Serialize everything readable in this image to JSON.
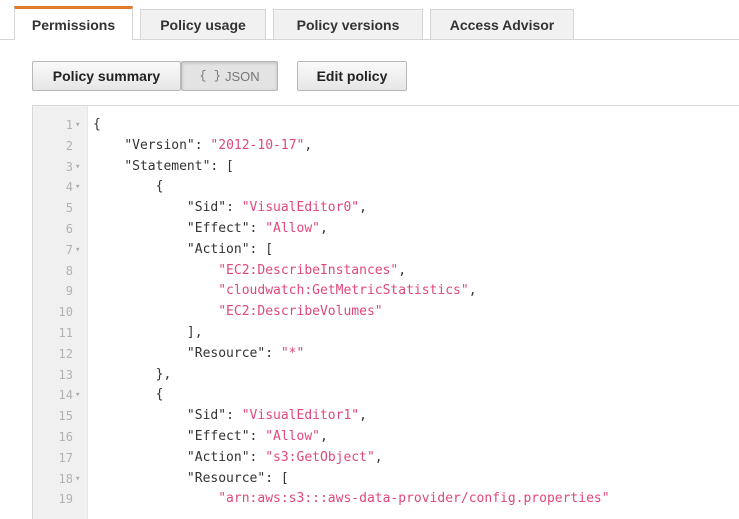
{
  "tabs": [
    {
      "label": "Permissions",
      "active": true
    },
    {
      "label": "Policy usage",
      "active": false
    },
    {
      "label": "Policy versions",
      "active": false
    },
    {
      "label": "Access Advisor",
      "active": false
    }
  ],
  "toolbar": {
    "policy_summary_label": "Policy summary",
    "json_braces": "{ }",
    "json_label": "JSON",
    "edit_policy_label": "Edit policy"
  },
  "colors": {
    "active_tab_accent": "#e07b2c",
    "json_string": "#e0487b",
    "json_key": "#333333"
  },
  "editor": {
    "lines": [
      {
        "n": "1",
        "fold": true,
        "indent": 0,
        "segs": [
          {
            "t": "p",
            "v": "{"
          }
        ]
      },
      {
        "n": "2",
        "fold": false,
        "indent": 1,
        "segs": [
          {
            "t": "k",
            "v": "\"Version\""
          },
          {
            "t": "p",
            "v": ": "
          },
          {
            "t": "s",
            "v": "\"2012-10-17\""
          },
          {
            "t": "p",
            "v": ","
          }
        ]
      },
      {
        "n": "3",
        "fold": true,
        "indent": 1,
        "segs": [
          {
            "t": "k",
            "v": "\"Statement\""
          },
          {
            "t": "p",
            "v": ": ["
          }
        ]
      },
      {
        "n": "4",
        "fold": true,
        "indent": 2,
        "segs": [
          {
            "t": "p",
            "v": "{"
          }
        ]
      },
      {
        "n": "5",
        "fold": false,
        "indent": 3,
        "segs": [
          {
            "t": "k",
            "v": "\"Sid\""
          },
          {
            "t": "p",
            "v": ": "
          },
          {
            "t": "s",
            "v": "\"VisualEditor0\""
          },
          {
            "t": "p",
            "v": ","
          }
        ]
      },
      {
        "n": "6",
        "fold": false,
        "indent": 3,
        "segs": [
          {
            "t": "k",
            "v": "\"Effect\""
          },
          {
            "t": "p",
            "v": ": "
          },
          {
            "t": "s",
            "v": "\"Allow\""
          },
          {
            "t": "p",
            "v": ","
          }
        ]
      },
      {
        "n": "7",
        "fold": true,
        "indent": 3,
        "segs": [
          {
            "t": "k",
            "v": "\"Action\""
          },
          {
            "t": "p",
            "v": ": ["
          }
        ]
      },
      {
        "n": "8",
        "fold": false,
        "indent": 4,
        "segs": [
          {
            "t": "s",
            "v": "\"EC2:DescribeInstances\""
          },
          {
            "t": "p",
            "v": ","
          }
        ]
      },
      {
        "n": "9",
        "fold": false,
        "indent": 4,
        "segs": [
          {
            "t": "s",
            "v": "\"cloudwatch:GetMetricStatistics\""
          },
          {
            "t": "p",
            "v": ","
          }
        ]
      },
      {
        "n": "10",
        "fold": false,
        "indent": 4,
        "segs": [
          {
            "t": "s",
            "v": "\"EC2:DescribeVolumes\""
          }
        ]
      },
      {
        "n": "11",
        "fold": false,
        "indent": 3,
        "segs": [
          {
            "t": "p",
            "v": "],"
          }
        ]
      },
      {
        "n": "12",
        "fold": false,
        "indent": 3,
        "segs": [
          {
            "t": "k",
            "v": "\"Resource\""
          },
          {
            "t": "p",
            "v": ": "
          },
          {
            "t": "s",
            "v": "\"*\""
          }
        ]
      },
      {
        "n": "13",
        "fold": false,
        "indent": 2,
        "segs": [
          {
            "t": "p",
            "v": "},"
          }
        ]
      },
      {
        "n": "14",
        "fold": true,
        "indent": 2,
        "segs": [
          {
            "t": "p",
            "v": "{"
          }
        ]
      },
      {
        "n": "15",
        "fold": false,
        "indent": 3,
        "segs": [
          {
            "t": "k",
            "v": "\"Sid\""
          },
          {
            "t": "p",
            "v": ": "
          },
          {
            "t": "s",
            "v": "\"VisualEditor1\""
          },
          {
            "t": "p",
            "v": ","
          }
        ]
      },
      {
        "n": "16",
        "fold": false,
        "indent": 3,
        "segs": [
          {
            "t": "k",
            "v": "\"Effect\""
          },
          {
            "t": "p",
            "v": ": "
          },
          {
            "t": "s",
            "v": "\"Allow\""
          },
          {
            "t": "p",
            "v": ","
          }
        ]
      },
      {
        "n": "17",
        "fold": false,
        "indent": 3,
        "segs": [
          {
            "t": "k",
            "v": "\"Action\""
          },
          {
            "t": "p",
            "v": ": "
          },
          {
            "t": "s",
            "v": "\"s3:GetObject\""
          },
          {
            "t": "p",
            "v": ","
          }
        ]
      },
      {
        "n": "18",
        "fold": true,
        "indent": 3,
        "segs": [
          {
            "t": "k",
            "v": "\"Resource\""
          },
          {
            "t": "p",
            "v": ": ["
          }
        ]
      },
      {
        "n": "19",
        "fold": false,
        "indent": 4,
        "segs": [
          {
            "t": "s",
            "v": "\"arn:aws:s3:::aws-data-provider/config.properties\""
          }
        ]
      }
    ]
  }
}
